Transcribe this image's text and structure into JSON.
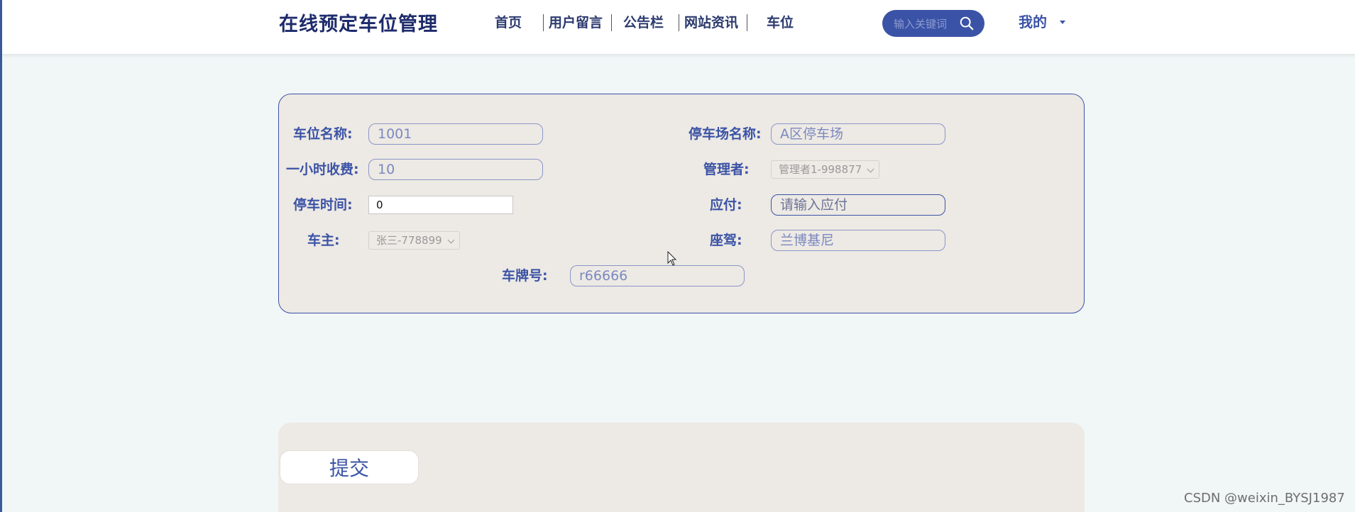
{
  "header": {
    "brand": "在线预定车位管理",
    "nav": [
      "首页",
      "用户留言",
      "公告栏",
      "网站资讯",
      "车位"
    ],
    "search_placeholder": "输入关键词",
    "user_menu": "我的"
  },
  "form": {
    "space_name": {
      "label": "车位名称:",
      "value": "1001"
    },
    "lot_name": {
      "label": "停车场名称:",
      "value": "A区停车场"
    },
    "hourly_fee": {
      "label": "一小时收费:",
      "value": "10"
    },
    "manager": {
      "label": "管理者:",
      "value": "管理者1-998877"
    },
    "parking_time": {
      "label": "停车时间:",
      "value": "0"
    },
    "payable": {
      "label": "应付:",
      "placeholder": "请输入应付"
    },
    "owner": {
      "label": "车主:",
      "value": "张三-778899"
    },
    "car_model": {
      "label": "座驾:",
      "value": "兰博基尼"
    },
    "plate": {
      "label": "车牌号:",
      "value": "r66666"
    }
  },
  "submit": {
    "label": "提交"
  },
  "watermark": "CSDN @weixin_BYSJ1987",
  "colors": {
    "accent": "#3b53a6",
    "brand": "#1d2b6b",
    "page_bg": "#f1f6f7",
    "card_bg": "#ede9e4"
  }
}
